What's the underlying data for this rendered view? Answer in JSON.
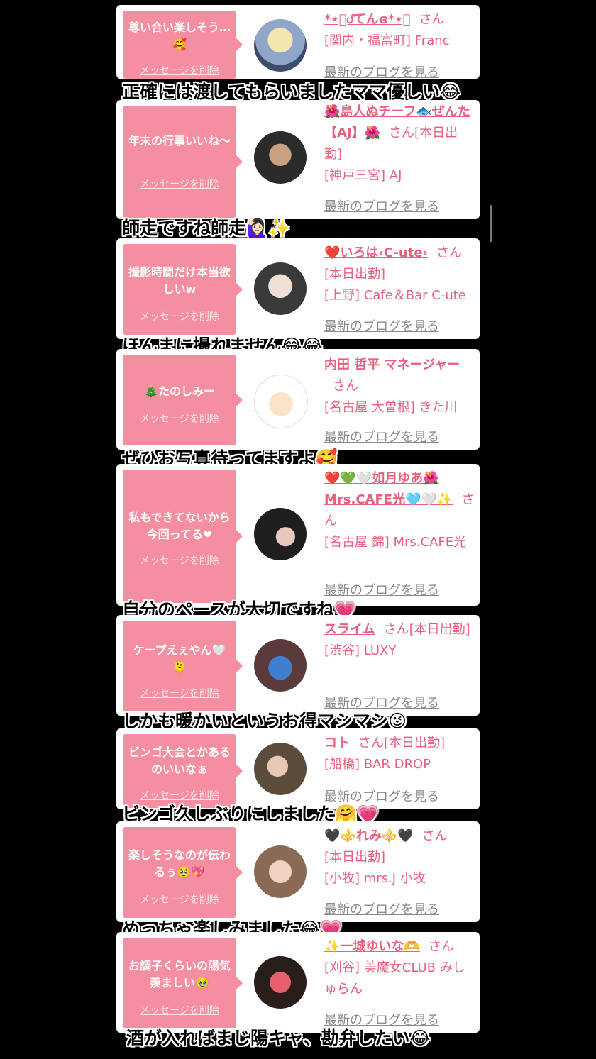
{
  "delete_label": "メッセージを削除",
  "blog_label": "最新のブログを見る",
  "san": "さん",
  "entries": [
    {
      "message": "尊い合い楽しそう…🥰",
      "name": "*⋆͛ᦔてんɞ*⋆͛",
      "info_lines": [
        "[関内・福富町] Franc"
      ],
      "caption": "正確には渡してもらいましたママ優しい😂"
    },
    {
      "message": "年末の行事いいね〜",
      "name": "🌺島人ぬチーフ🐟ぜんた【AJ】🌺",
      "san_suffix": "[本日出勤]",
      "info_lines": [
        "[神戸三宮] AJ"
      ],
      "caption": "師走ですね師走🙋🏻‍♀️✨"
    },
    {
      "message": "撮影時間だけ本当欲しいw",
      "name": "❤️いろは‹C-ute›",
      "info_lines": [
        "[本日出勤]",
        "[上野] Cafe＆Bar C-ute"
      ],
      "caption": "ほんまに撮れません😂😂"
    },
    {
      "message": "🎄たのしみー",
      "name": "内田 哲平 マネージャー",
      "info_lines": [
        "[名古屋 大曽根] きた川"
      ],
      "caption": "ぜひお写真待ってますよ🥰"
    },
    {
      "message": "私もできてないから今回ってる❤︎",
      "name": "❤️💚🤍如月ゆあ🌺Mrs.CAFE光🩵🤍✨",
      "info_lines": [
        "[名古屋 錦] Mrs.CAFE光"
      ],
      "caption": "自分のペースが大切ですね💗"
    },
    {
      "message": "ケープえぇやん🤍🫠",
      "name": "スライム",
      "san_suffix": "[本日出勤]",
      "info_lines": [
        "[渋谷] LUXY"
      ],
      "caption": "しかも暖かいというお得マシマシ😉"
    },
    {
      "message": "ビンゴ大会とかあるのいいなぁ",
      "name": "コト",
      "san_suffix": "[本日出勤]",
      "info_lines": [
        "[船橋] BAR DROP"
      ],
      "caption": "ビンゴ久しぶりにしました🤗💗"
    },
    {
      "message": "楽しそうなのが伝わるぅ🥹💖",
      "name": "🖤⚜️れみ⚜️🖤",
      "info_lines": [
        "[本日出勤]",
        "[小牧] mrs.J 小牧"
      ],
      "caption": "めっちゃ楽しみました😂💗"
    },
    {
      "message": "お調子くらいの陽気羨ましい🥹",
      "name": "✨一城ゆいな🫶",
      "info_lines": [
        "[刈谷] 美魔女CLUB みしゅらん"
      ],
      "caption": "酒が入ればまじ陽キャ、勘弁したい😂"
    }
  ],
  "colors": {
    "bubble": "#f48ea0",
    "name": "#e8607e",
    "link": "#8b8b8b",
    "background": "#000000"
  },
  "icons": [
    "avatar-1",
    "avatar-2",
    "avatar-3",
    "avatar-4",
    "avatar-5",
    "avatar-6",
    "avatar-7",
    "avatar-8",
    "avatar-9"
  ]
}
